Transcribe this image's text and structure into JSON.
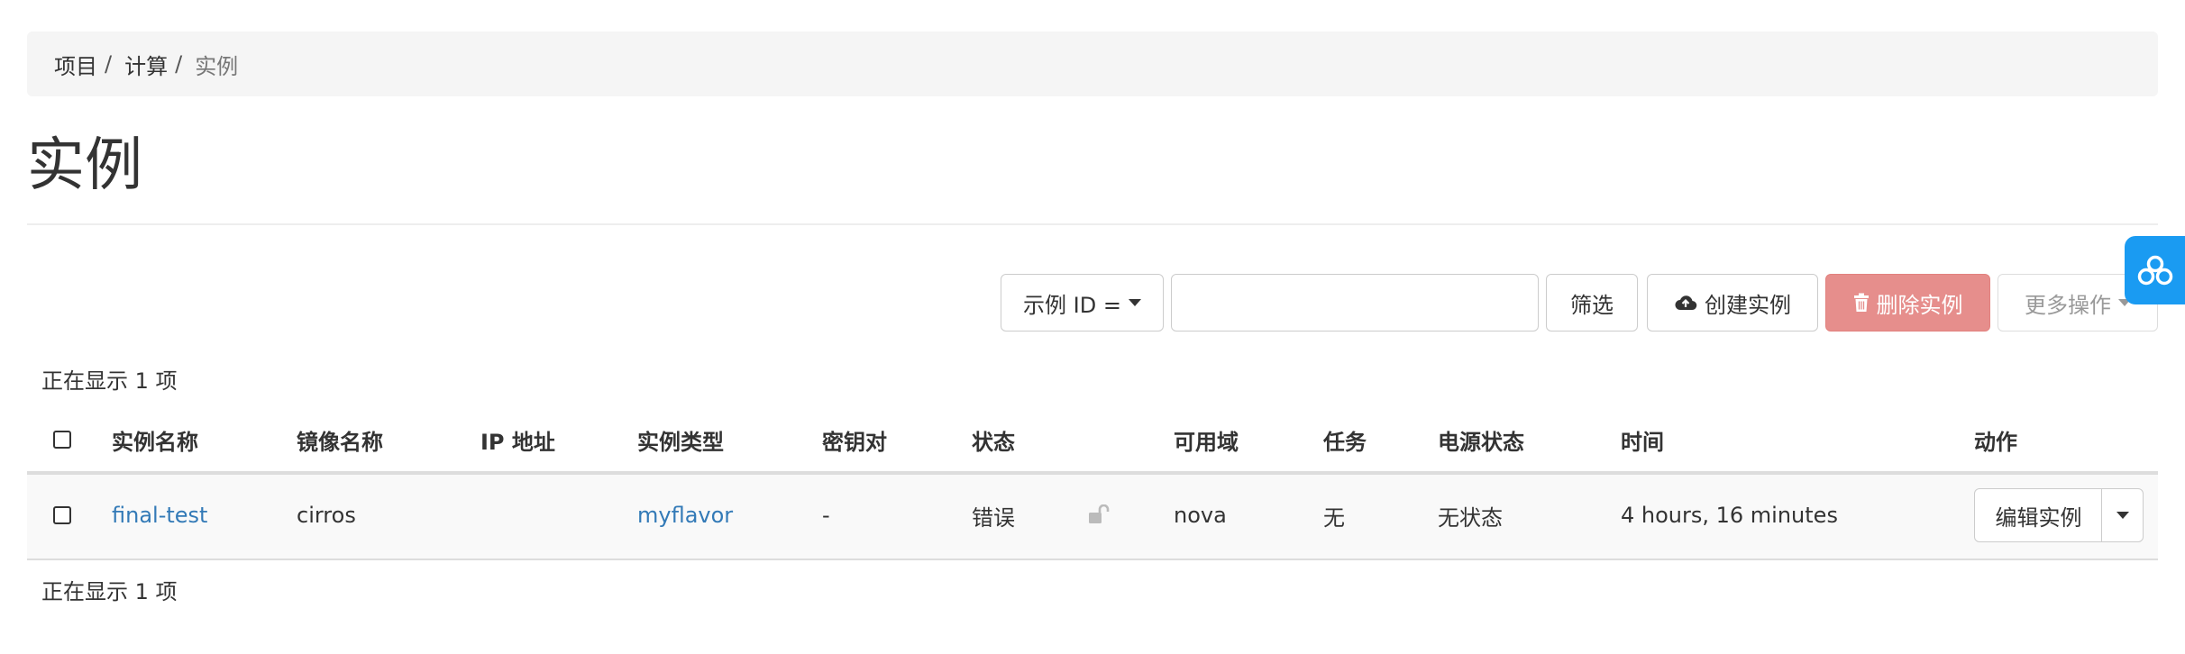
{
  "breadcrumb": {
    "items": [
      "项目",
      "计算",
      "实例"
    ],
    "separator": "/"
  },
  "page": {
    "title": "实例"
  },
  "toolbar": {
    "filter_field_label": "示例 ID =",
    "filter_input_value": "",
    "filter_button": "筛选",
    "create_button": "创建实例",
    "delete_button": "删除实例",
    "more_actions_button": "更多操作"
  },
  "summary": {
    "top": "正在显示 1 项",
    "bottom": "正在显示 1 项"
  },
  "table": {
    "columns": [
      "实例名称",
      "镜像名称",
      "IP 地址",
      "实例类型",
      "密钥对",
      "状态",
      "可用域",
      "任务",
      "电源状态",
      "时间",
      "动作"
    ],
    "rows": [
      {
        "instance_name": "final-test",
        "image_name": "cirros",
        "ip_address": "",
        "flavor": "myflavor",
        "key_pair": "-",
        "status": "错误",
        "status_icon": "unlocked-icon",
        "availability_zone": "nova",
        "task": "无",
        "power_state": "无状态",
        "time": "4 hours, 16 minutes",
        "action_label": "编辑实例"
      }
    ]
  },
  "colors": {
    "link": "#337ab7",
    "danger": "#d9534f",
    "widget": "#1a9bf2",
    "breadcrumb_bg": "#f5f5f5"
  },
  "icons": {
    "create": "cloud-upload-icon",
    "delete": "trash-icon",
    "widget": "cloud-share-icon"
  }
}
